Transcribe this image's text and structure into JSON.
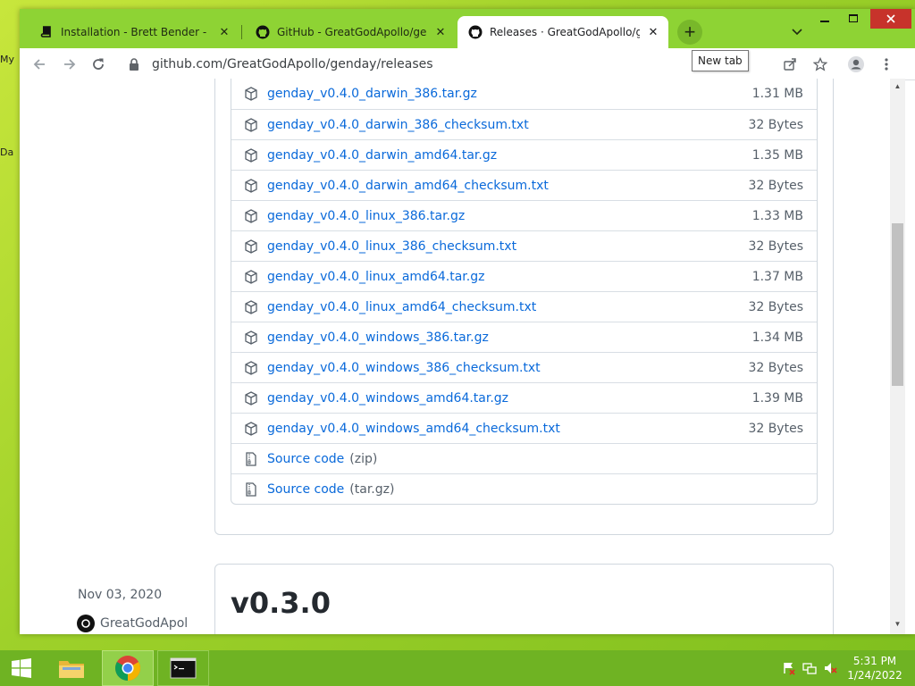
{
  "desktop": {
    "labels": [
      "My",
      "Da"
    ]
  },
  "browser": {
    "tabs": [
      {
        "title": "Installation - Brett Bender - Docs",
        "icon": "book-icon",
        "active": false
      },
      {
        "title": "GitHub - GreatGodApollo/genday",
        "icon": "github-icon",
        "active": false
      },
      {
        "title": "Releases · GreatGodApollo/genday",
        "icon": "github-icon",
        "active": true
      }
    ],
    "new_tab_label": "+",
    "tooltip": "New tab",
    "url": "github.com/GreatGodApollo/genday/releases",
    "colors": {
      "frame": "#8ed334",
      "link": "#0969da",
      "muted": "#57606a"
    }
  },
  "assets": [
    {
      "name": "genday_v0.4.0_darwin_386.tar.gz",
      "size": "1.31 MB",
      "icon": "package-icon"
    },
    {
      "name": "genday_v0.4.0_darwin_386_checksum.txt",
      "size": "32 Bytes",
      "icon": "package-icon"
    },
    {
      "name": "genday_v0.4.0_darwin_amd64.tar.gz",
      "size": "1.35 MB",
      "icon": "package-icon"
    },
    {
      "name": "genday_v0.4.0_darwin_amd64_checksum.txt",
      "size": "32 Bytes",
      "icon": "package-icon"
    },
    {
      "name": "genday_v0.4.0_linux_386.tar.gz",
      "size": "1.33 MB",
      "icon": "package-icon"
    },
    {
      "name": "genday_v0.4.0_linux_386_checksum.txt",
      "size": "32 Bytes",
      "icon": "package-icon"
    },
    {
      "name": "genday_v0.4.0_linux_amd64.tar.gz",
      "size": "1.37 MB",
      "icon": "package-icon"
    },
    {
      "name": "genday_v0.4.0_linux_amd64_checksum.txt",
      "size": "32 Bytes",
      "icon": "package-icon"
    },
    {
      "name": "genday_v0.4.0_windows_386.tar.gz",
      "size": "1.34 MB",
      "icon": "package-icon"
    },
    {
      "name": "genday_v0.4.0_windows_386_checksum.txt",
      "size": "32 Bytes",
      "icon": "package-icon"
    },
    {
      "name": "genday_v0.4.0_windows_amd64.tar.gz",
      "size": "1.39 MB",
      "icon": "package-icon"
    },
    {
      "name": "genday_v0.4.0_windows_amd64_checksum.txt",
      "size": "32 Bytes",
      "icon": "package-icon"
    }
  ],
  "source_code": [
    {
      "name": "Source code",
      "suffix": "(zip)",
      "icon": "file-zip-icon"
    },
    {
      "name": "Source code",
      "suffix": "(tar.gz)",
      "icon": "file-zip-icon"
    }
  ],
  "next_release": {
    "date": "Nov 03, 2020",
    "author": "GreatGodApol",
    "version": "v0.3.0"
  },
  "taskbar": {
    "clock_time": "5:31 PM",
    "clock_date": "1/24/2022"
  }
}
